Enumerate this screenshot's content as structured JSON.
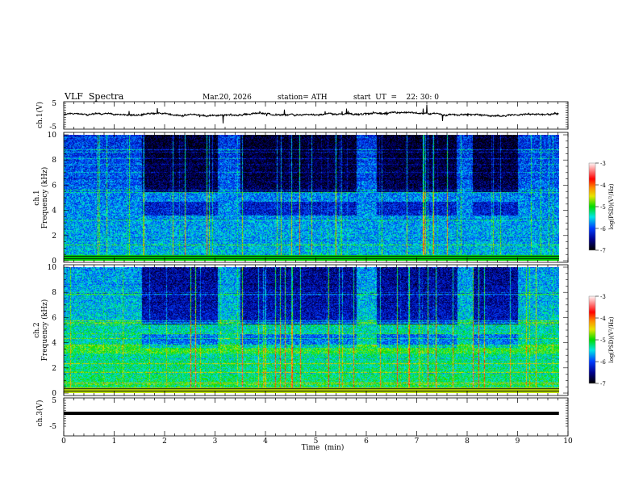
{
  "header": {
    "title": "VLF  Spectra",
    "date": "Mar.20, 2026",
    "station": "station= ATH",
    "start": "start  UT  =    22: 30: 0"
  },
  "chart_data": {
    "type": "heatmap",
    "xlabel": "Time  (min)",
    "xlim": [
      0,
      10
    ],
    "xticks": [
      "0",
      "1",
      "2",
      "3",
      "4",
      "5",
      "6",
      "7",
      "8",
      "9",
      "10"
    ],
    "data_end_min": 9.82,
    "panels": [
      {
        "name": "ch1-voltage",
        "type": "line",
        "ylabel": "ch.1(V)",
        "ylim": [
          -5,
          5
        ],
        "yticks": [
          "5",
          "-5"
        ]
      },
      {
        "name": "ch1-spectrogram",
        "type": "heatmap",
        "ylabel": "ch.1\nFrequency (kHz)",
        "ylabel_top": "ch.1",
        "ylabel_bottom": "Frequency  (kHz)",
        "ylim": [
          0,
          10
        ],
        "yticks": [
          "0",
          "2",
          "4",
          "6",
          "8",
          "10"
        ],
        "colorbar": {
          "label": "log(PSD)(V²/Hz)",
          "range": [
            -7,
            -3
          ],
          "ticks": [
            "-3",
            "-4",
            "-5",
            "-6",
            "-7"
          ]
        }
      },
      {
        "name": "ch2-spectrogram",
        "type": "heatmap",
        "ylabel_top": "ch.2",
        "ylabel_bottom": "Frequency  (kHz)",
        "ylim": [
          0,
          10
        ],
        "yticks": [
          "0",
          "2",
          "4",
          "6",
          "8",
          "10"
        ],
        "colorbar": {
          "label": "log(PSD)(V²/Hz)",
          "range": [
            -7,
            -3
          ],
          "ticks": [
            "-3",
            "-4",
            "-5",
            "-6",
            "-7"
          ]
        }
      },
      {
        "name": "ch3-voltage",
        "type": "line",
        "ylabel": "ch.3(V)",
        "ylim": [
          -5,
          5
        ],
        "yticks": [
          "5",
          "-5"
        ],
        "level": 0
      }
    ],
    "quiet_intervals_min": [
      [
        1.55,
        3.05
      ],
      [
        3.5,
        5.8
      ],
      [
        6.2,
        7.8
      ],
      [
        8.1,
        9.0
      ]
    ]
  },
  "colors": {
    "frame": "#000000",
    "trace": "#000000"
  }
}
